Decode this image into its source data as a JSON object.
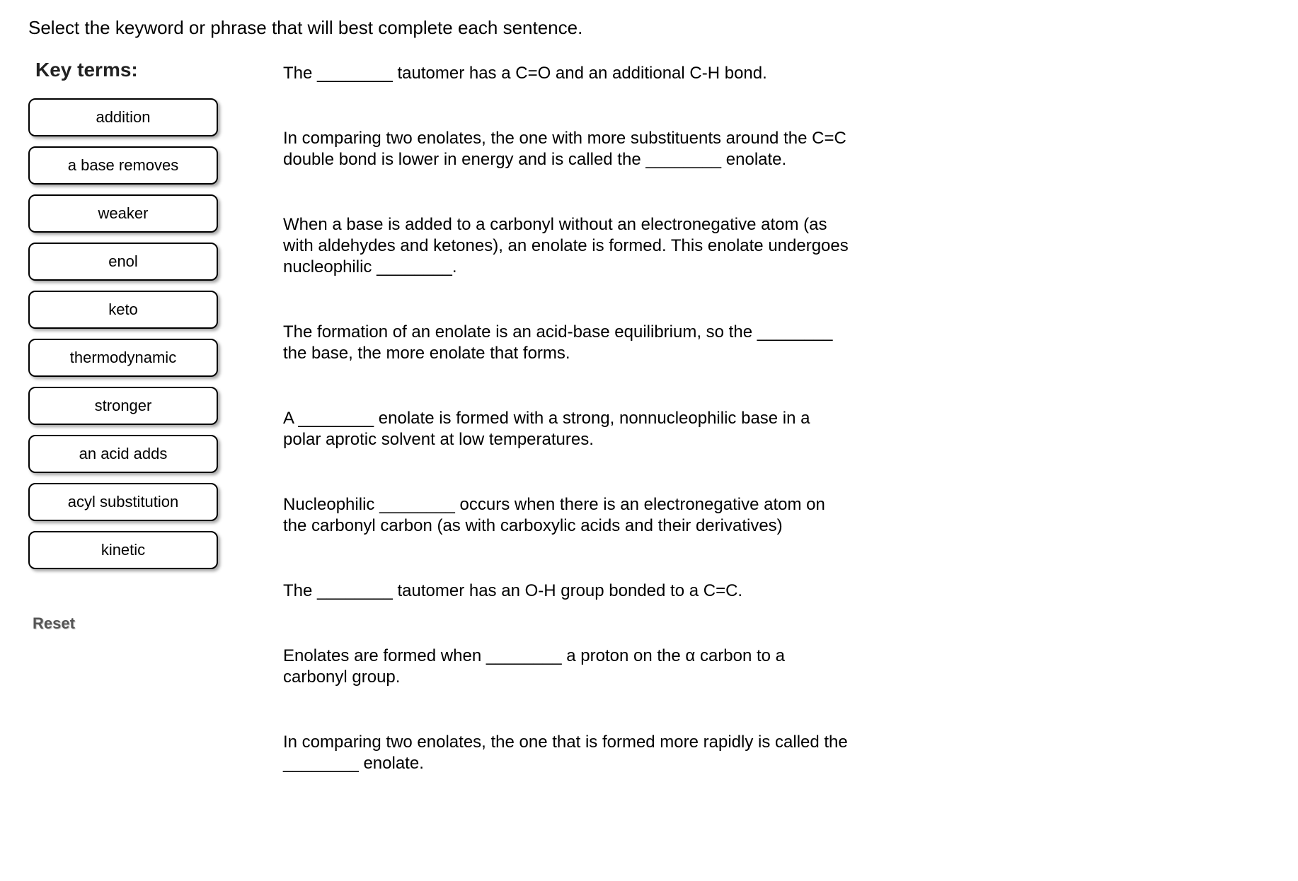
{
  "instruction": "Select the keyword or phrase that will best complete each sentence.",
  "key_terms_heading": "Key terms:",
  "terms": [
    "addition",
    "a base removes",
    "weaker",
    "enol",
    "keto",
    "thermodynamic",
    "stronger",
    "an acid adds",
    "acyl substitution",
    "kinetic"
  ],
  "sentences": [
    "The ________ tautomer has a C=O and an additional C-H bond.",
    "In comparing two enolates, the one with more substituents around the C=C double bond is lower in energy and is called the ________ enolate.",
    "When a base is added to a carbonyl without an electronegative atom (as with aldehydes and ketones), an enolate is formed.  This enolate undergoes nucleophilic ________.",
    "The formation of an enolate is an acid-base equilibrium, so the ________ the base, the more enolate that forms.",
    "A ________ enolate is formed with a strong, nonnucleophilic base in a polar aprotic solvent at low temperatures.",
    "Nucleophilic ________ occurs when there is an electronegative atom on the carbonyl carbon (as with carboxylic acids and their derivatives)",
    "The ________ tautomer has an O-H group bonded to a C=C.",
    "Enolates are formed when ________ a proton on the α carbon to a carbonyl group.",
    "In comparing two enolates, the one that is formed more rapidly is called the ________ enolate."
  ],
  "reset_label": "Reset"
}
